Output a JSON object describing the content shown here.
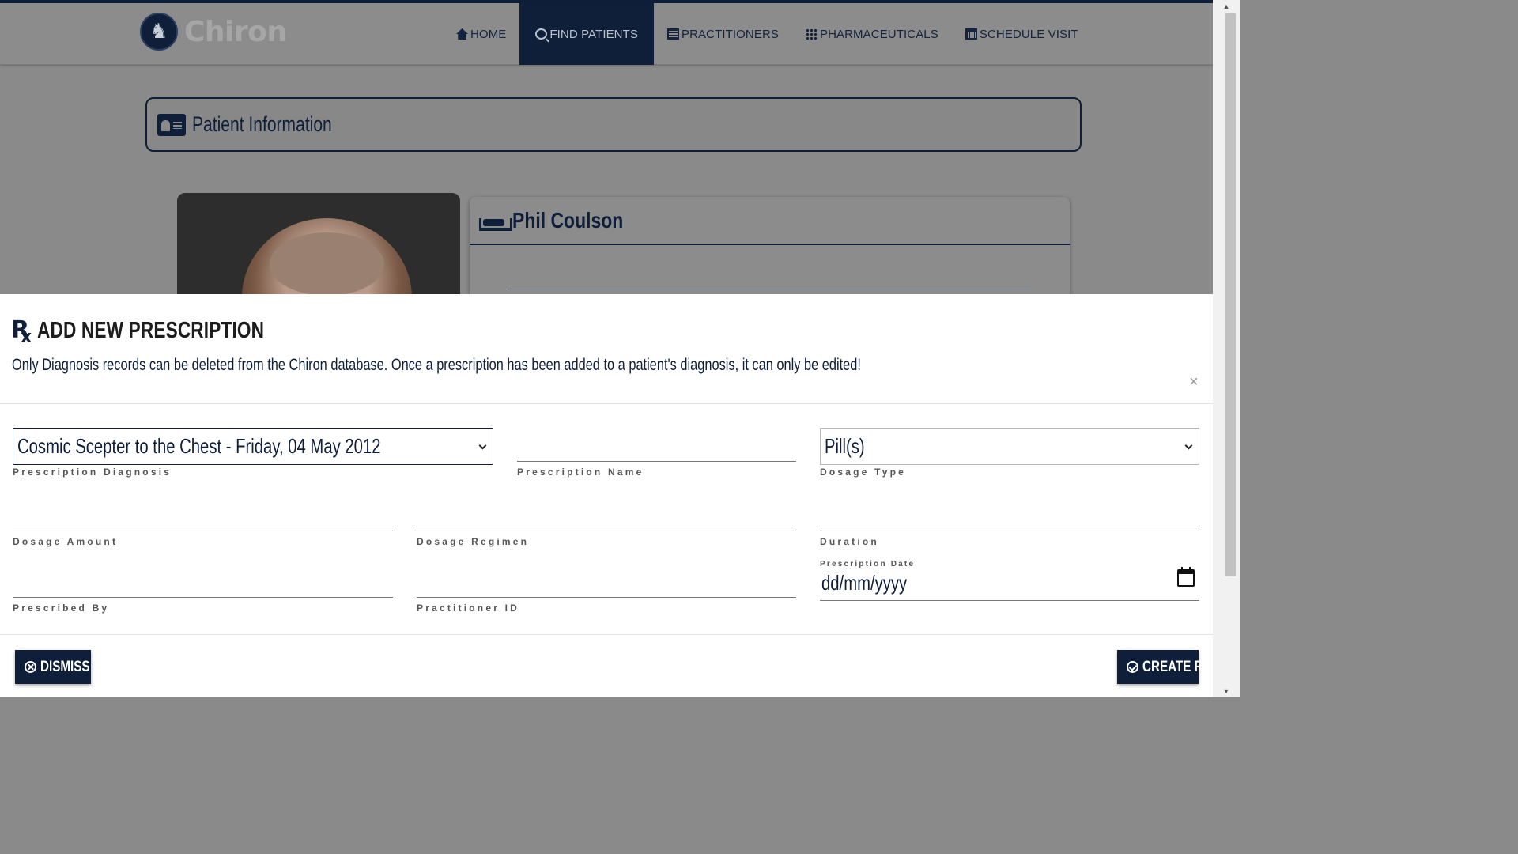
{
  "app": {
    "name": "Chiron"
  },
  "nav": {
    "items": [
      {
        "label": "HOME",
        "icon": "home-icon"
      },
      {
        "label": "FIND PATIENTS",
        "icon": "search-icon",
        "active": true
      },
      {
        "label": "PRACTITIONERS",
        "icon": "list-icon"
      },
      {
        "label": "PHARMACEUTICALS",
        "icon": "grid-icon"
      },
      {
        "label": "SCHEDULE VISIT",
        "icon": "calendar-icon"
      }
    ]
  },
  "page": {
    "section_title": "Patient Information",
    "patient_name": "Phil Coulson"
  },
  "modal": {
    "title": "ADD NEW PRESCRIPTION",
    "description": "Only Diagnosis records can be deleted from the Chiron database. Once a prescription has been added to a patient's diagnosis, it can only be edited!",
    "close": "×",
    "fields": {
      "diagnosis": {
        "label": "Prescription Diagnosis",
        "value": "Cosmic Scepter to the Chest - Friday, 04 May 2012"
      },
      "name": {
        "label": "Prescription Name",
        "value": ""
      },
      "dosage_type": {
        "label": "Dosage Type",
        "value": "Pill(s)"
      },
      "dosage_amount": {
        "label": "Dosage Amount",
        "value": ""
      },
      "dosage_regimen": {
        "label": "Dosage Regimen",
        "value": ""
      },
      "duration": {
        "label": "Duration",
        "value": ""
      },
      "prescribed_by": {
        "label": "Prescribed By",
        "value": ""
      },
      "practitioner_id": {
        "label": "Practitioner ID",
        "value": ""
      },
      "prescription_date": {
        "label": "Prescription Date",
        "value": "dd/mm/yyyy"
      }
    },
    "buttons": {
      "dismiss": "DISMISS",
      "create": "CREATE RX"
    }
  },
  "colors": {
    "primary": "#0f1f3a",
    "overlay": "#8a8a8a",
    "modal_bg": "#ffffff"
  }
}
